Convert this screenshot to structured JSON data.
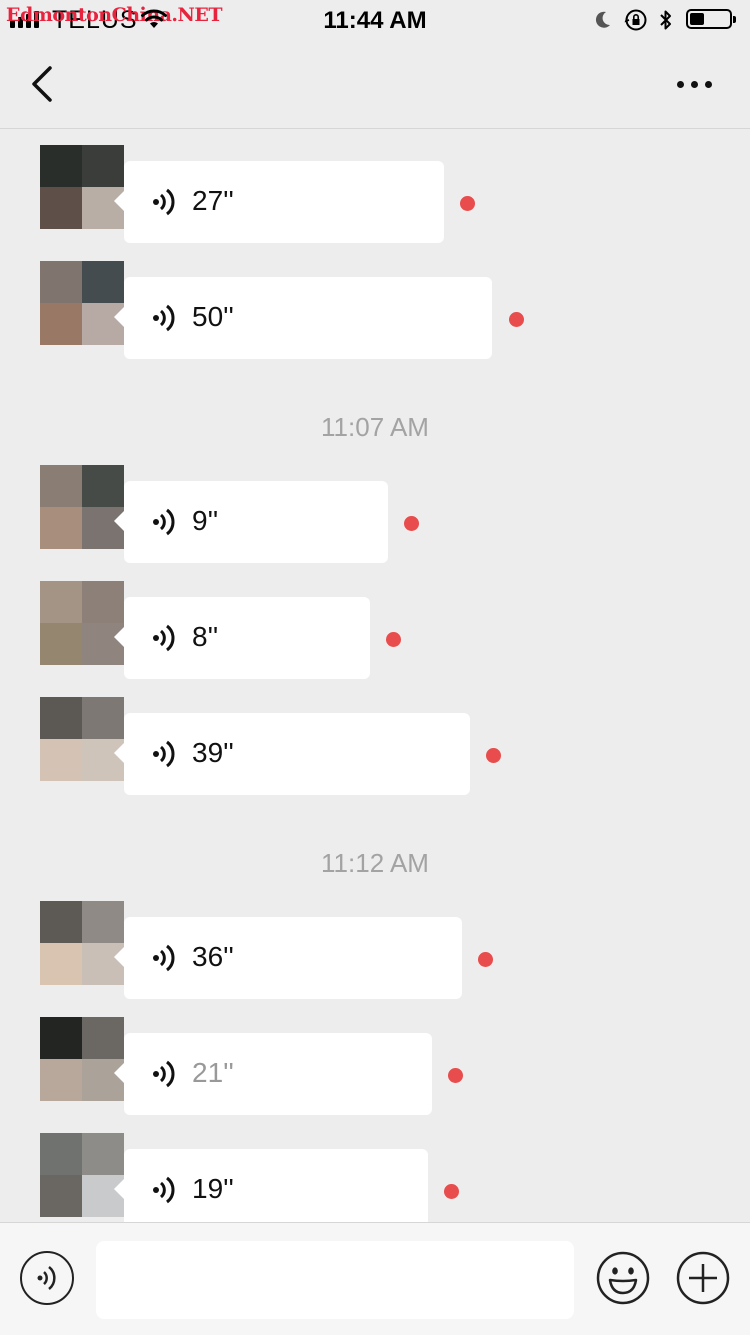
{
  "status_bar": {
    "watermark": "EdmontonChina.NET",
    "carrier": "TELUS",
    "time": "11:44 AM",
    "battery_level": 0.3
  },
  "nav": {
    "title": ""
  },
  "messages": [
    {
      "duration": "27''",
      "unread": true
    },
    {
      "duration": "50''",
      "unread": true
    },
    {
      "duration": "9''",
      "unread": true
    },
    {
      "duration": "8''",
      "unread": true
    },
    {
      "duration": "39''",
      "unread": true
    },
    {
      "duration": "36''",
      "unread": true
    },
    {
      "duration": "21''",
      "unread": true
    },
    {
      "duration": "19''",
      "unread": true
    }
  ],
  "timestamps": [
    "11:07 AM",
    "11:12 AM"
  ],
  "input_bar": {
    "text_value": ""
  },
  "colors": {
    "background": "#ededed",
    "bubble": "#ffffff",
    "unread_dot": "#e84c4c",
    "timestamp": "#a3a3a3"
  },
  "icons": [
    "back-chevron-icon",
    "more-dots-icon",
    "voice-icon",
    "emoji-icon",
    "plus-icon"
  ]
}
